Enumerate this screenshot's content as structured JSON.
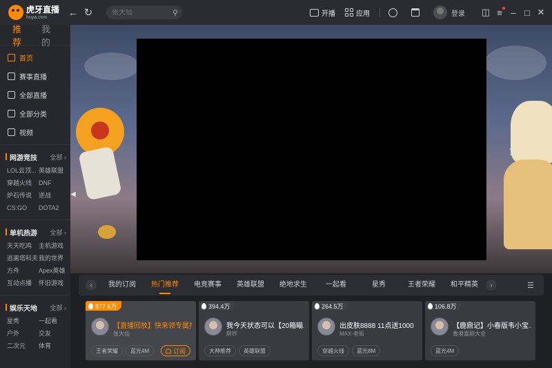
{
  "titlebar": {
    "logo_main": "虎牙直播",
    "logo_sub": "huya.com",
    "search_placeholder": "张大仙",
    "open_broadcast": "开播",
    "apps": "应用",
    "login": "登录"
  },
  "sidebar": {
    "tabs": [
      "推荐",
      "我的"
    ],
    "nav": [
      "首页",
      "赛事直播",
      "全部直播",
      "全部分类",
      "视频"
    ],
    "sections": [
      {
        "title": "网游竞技",
        "all": "全部",
        "items": [
          "LOL云顶...",
          "英雄联盟",
          "穿越火线",
          "DNF",
          "炉石传说",
          "逆战",
          "CS:GO",
          "DOTA2"
        ]
      },
      {
        "title": "单机热游",
        "all": "全部",
        "items": [
          "天天吃鸡",
          "主机游戏",
          "逃离塔科夫",
          "我的世界",
          "方舟",
          "Apex英雄",
          "互动点播",
          "怀旧游戏"
        ]
      },
      {
        "title": "娱乐天地",
        "all": "全部",
        "items": [
          "星秀",
          "一起看",
          "户外",
          "交友",
          "二次元",
          "体育"
        ]
      }
    ]
  },
  "tabs": [
    "我的订阅",
    "热门推荐",
    "电竞赛事",
    "英雄联盟",
    "绝地求生",
    "一起看",
    "星秀",
    "王者荣耀",
    "和平精英"
  ],
  "cards": [
    {
      "heat": "877.6万",
      "title": "【直播回放】快来领专属抱...",
      "author": "张大仙",
      "tags": [
        "王者荣耀",
        "蓝光4M"
      ],
      "subscribe": "订阅"
    },
    {
      "heat": "394.4万",
      "title": "我今天状态可以【20箱瞄...",
      "author": "胖炸",
      "tags": [
        "大神推荐",
        "英雄联盟"
      ]
    },
    {
      "heat": "264.5万",
      "title": "出皮肤8888 11点送1000",
      "author": "MAX-老街",
      "tags": [
        "穿越火线",
        "蓝光8M"
      ]
    },
    {
      "heat": "106.8万",
      "title": "【鹿鼎记】小春版韦小宝...",
      "author": "香港喜剧大全",
      "tags": [
        "蓝光4M"
      ]
    }
  ]
}
